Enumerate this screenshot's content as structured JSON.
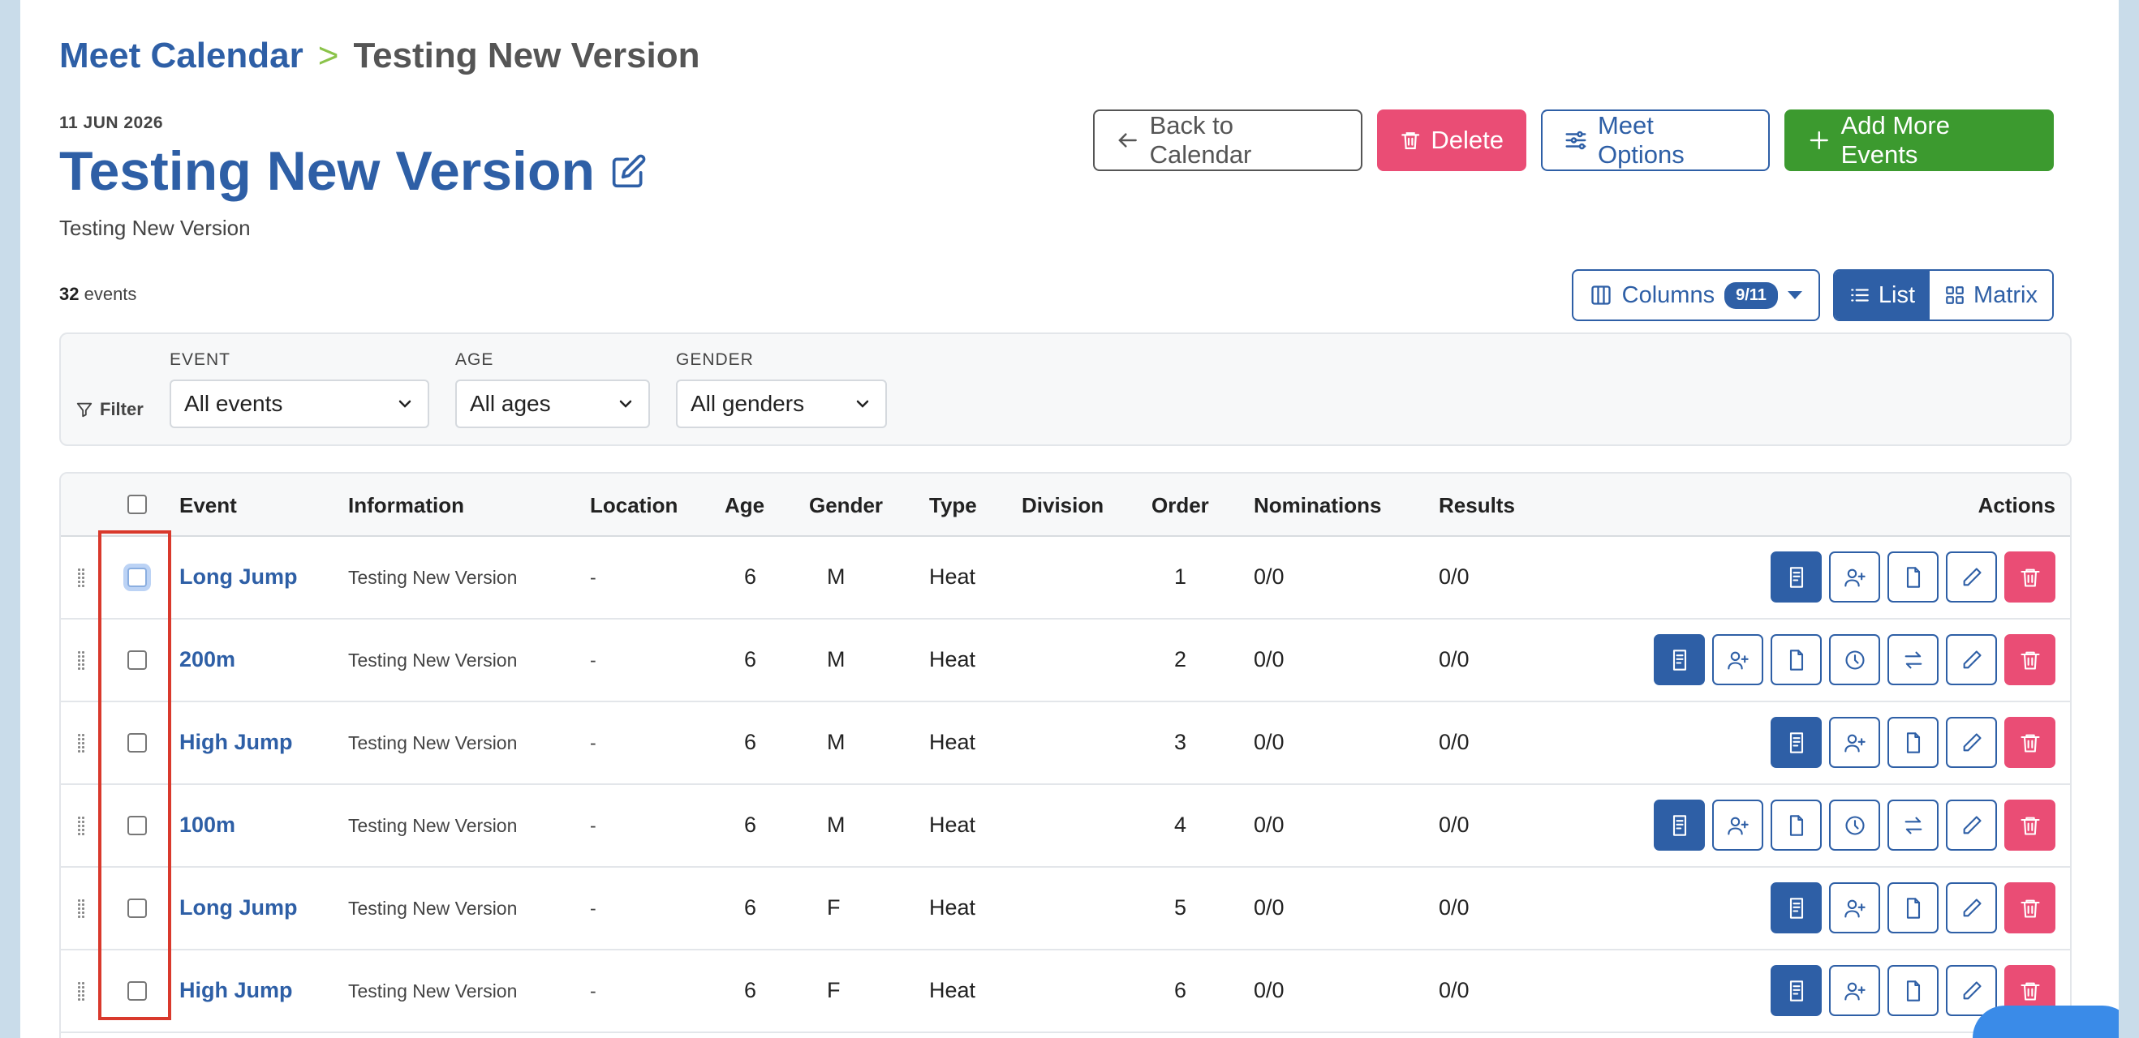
{
  "breadcrumb": {
    "parent": "Meet Calendar",
    "separator": ">",
    "current": "Testing New Version"
  },
  "meet": {
    "date": "11 JUN 2026",
    "title": "Testing New Version",
    "subtitle": "Testing New Version"
  },
  "buttons": {
    "back": "Back to Calendar",
    "delete": "Delete",
    "options": "Meet Options",
    "add": "Add More Events"
  },
  "summary": {
    "count": "32",
    "count_suffix": " events"
  },
  "view": {
    "columns_label": "Columns",
    "columns_badge": "9/11",
    "list_label": "List",
    "matrix_label": "Matrix",
    "active": "list"
  },
  "filters": {
    "label": "Filter",
    "event": {
      "label": "EVENT",
      "value": "All events"
    },
    "age": {
      "label": "AGE",
      "value": "All ages"
    },
    "gender": {
      "label": "GENDER",
      "value": "All genders"
    }
  },
  "table": {
    "columns": {
      "event": "Event",
      "information": "Information",
      "location": "Location",
      "age": "Age",
      "gender": "Gender",
      "type": "Type",
      "division": "Division",
      "order": "Order",
      "nominations": "Nominations",
      "results": "Results",
      "actions": "Actions"
    },
    "rows": [
      {
        "event": "Long Jump",
        "information": "Testing New Version",
        "location": "-",
        "age": "6",
        "gender": "M",
        "type": "Heat",
        "division": "",
        "order": "1",
        "nominations": "0/0",
        "results": "0/0",
        "track": false,
        "focused": true
      },
      {
        "event": "200m",
        "information": "Testing New Version",
        "location": "-",
        "age": "6",
        "gender": "M",
        "type": "Heat",
        "division": "",
        "order": "2",
        "nominations": "0/0",
        "results": "0/0",
        "track": true,
        "focused": false
      },
      {
        "event": "High Jump",
        "information": "Testing New Version",
        "location": "-",
        "age": "6",
        "gender": "M",
        "type": "Heat",
        "division": "",
        "order": "3",
        "nominations": "0/0",
        "results": "0/0",
        "track": false,
        "focused": false
      },
      {
        "event": "100m",
        "information": "Testing New Version",
        "location": "-",
        "age": "6",
        "gender": "M",
        "type": "Heat",
        "division": "",
        "order": "4",
        "nominations": "0/0",
        "results": "0/0",
        "track": true,
        "focused": false
      },
      {
        "event": "Long Jump",
        "information": "Testing New Version",
        "location": "-",
        "age": "6",
        "gender": "F",
        "type": "Heat",
        "division": "",
        "order": "5",
        "nominations": "0/0",
        "results": "0/0",
        "track": false,
        "focused": false
      },
      {
        "event": "High Jump",
        "information": "Testing New Version",
        "location": "-",
        "age": "6",
        "gender": "F",
        "type": "Heat",
        "division": "",
        "order": "6",
        "nominations": "0/0",
        "results": "0/0",
        "track": false,
        "focused": false
      }
    ]
  },
  "colors": {
    "primary": "#2e5fa6",
    "danger": "#ea4d75",
    "success": "#3c9a2f",
    "highlight": "#d9392c"
  }
}
